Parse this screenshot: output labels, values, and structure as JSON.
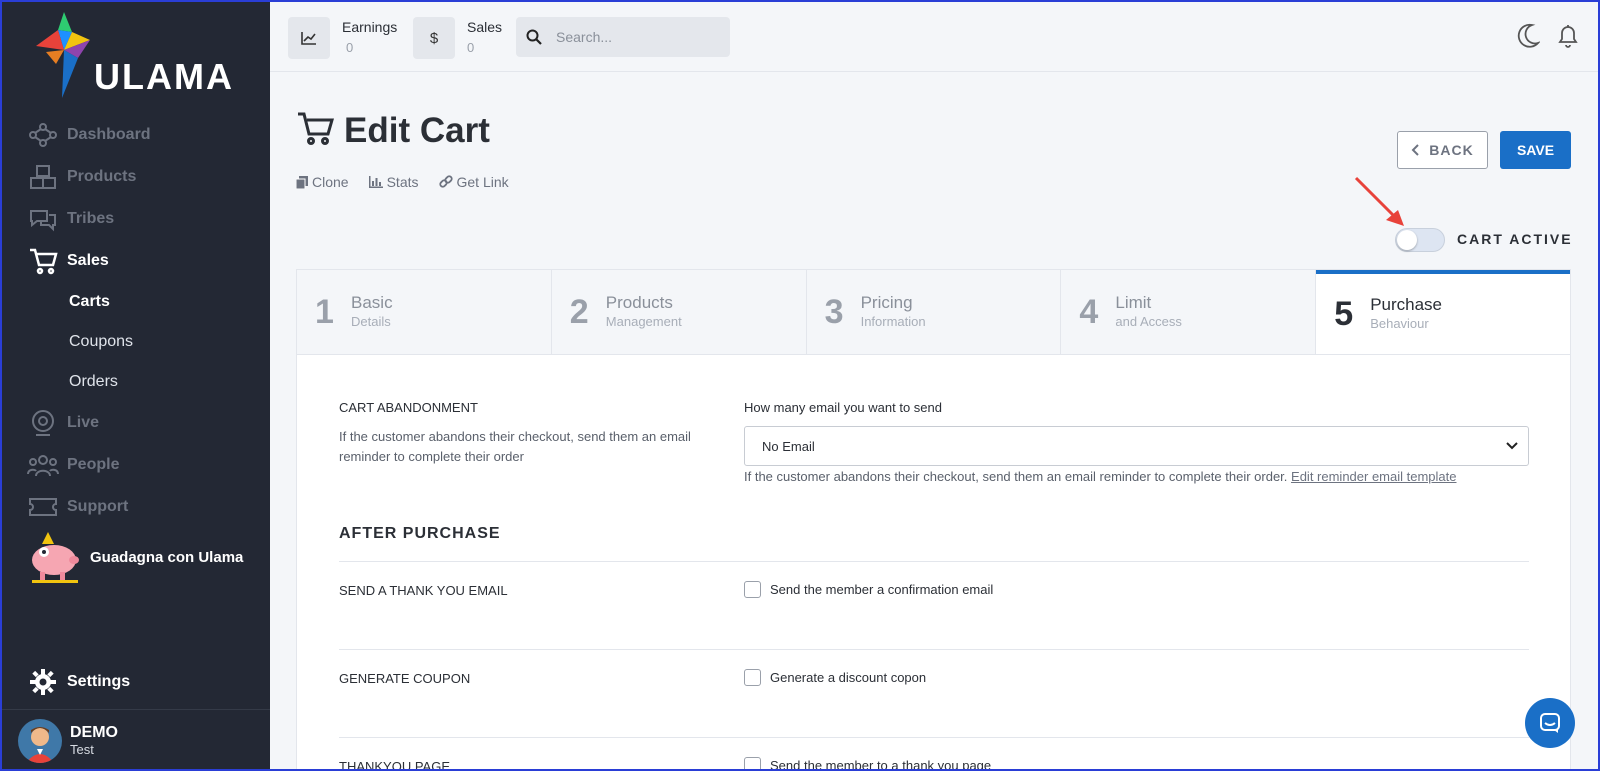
{
  "brand": {
    "name": "ULAMA"
  },
  "sidebar": {
    "items": [
      {
        "label": "Dashboard",
        "icon": "network-icon"
      },
      {
        "label": "Products",
        "icon": "boxes-icon"
      },
      {
        "label": "Tribes",
        "icon": "chat-icon"
      },
      {
        "label": "Sales",
        "icon": "cart-icon"
      },
      {
        "label": "Live",
        "icon": "webcam-icon"
      },
      {
        "label": "People",
        "icon": "people-icon"
      },
      {
        "label": "Support",
        "icon": "ticket-icon"
      }
    ],
    "sub_items": [
      "Carts",
      "Coupons",
      "Orders"
    ],
    "promo_label": "Guadagna con Ulama",
    "settings_label": "Settings",
    "user": {
      "name": "DEMO",
      "role": "Test"
    }
  },
  "topbar": {
    "earnings_label": "Earnings",
    "earnings_value": "0",
    "sales_label": "Sales",
    "sales_value": "0",
    "sales_symbol": "$",
    "search_placeholder": "Search..."
  },
  "page": {
    "title": "Edit Cart",
    "actions": [
      "Clone",
      "Stats",
      "Get Link"
    ],
    "back_label": "BACK",
    "save_label": "SAVE",
    "toggle_label": "CART ACTIVE",
    "toggle_on": false
  },
  "steps": [
    {
      "num": "1",
      "title": "Basic",
      "sub": "Details"
    },
    {
      "num": "2",
      "title": "Products",
      "sub": "Management"
    },
    {
      "num": "3",
      "title": "Pricing",
      "sub": "Information"
    },
    {
      "num": "4",
      "title": "Limit",
      "sub": "and Access"
    },
    {
      "num": "5",
      "title": "Purchase",
      "sub": "Behaviour"
    }
  ],
  "form": {
    "abandon_label": "CART ABANDONMENT",
    "abandon_desc": "If the customer abandons their checkout, send them an email reminder to complete their order",
    "email_count_label": "How many email you want to send",
    "email_count_value": "No Email",
    "email_help": "If the customer abandons their checkout, send them an email reminder to complete their order.",
    "email_help_link": "Edit reminder email template",
    "after_purchase_heading": "AFTER PURCHASE",
    "thankyou_email_label": "SEND A THANK YOU EMAIL",
    "thankyou_email_check": "Send the member a confirmation email",
    "coupon_label": "GENERATE COUPON",
    "coupon_check": "Generate a discount copon",
    "thankyou_page_label": "THANKYOU PAGE",
    "thankyou_page_check": "Send the member to a thank you page"
  },
  "colors": {
    "accent": "#1a6fc7",
    "sidebar": "#232834",
    "annotation_arrow": "#e8423a"
  }
}
